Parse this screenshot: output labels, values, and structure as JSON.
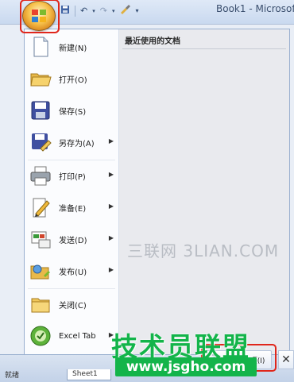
{
  "window": {
    "title": "Book1 - Microsof"
  },
  "quick_access": {
    "icons": [
      "save-icon",
      "undo-icon",
      "redo-icon",
      "brush-icon",
      "customize-icon"
    ]
  },
  "menu": {
    "items": [
      {
        "label": "新建(N)",
        "icon": "new-document-icon",
        "submenu": false
      },
      {
        "label": "打开(O)",
        "icon": "open-folder-icon",
        "submenu": false
      },
      {
        "label": "保存(S)",
        "icon": "save-icon",
        "submenu": false
      },
      {
        "label": "另存为(A)",
        "icon": "save-as-icon",
        "submenu": true
      },
      {
        "label": "打印(P)",
        "icon": "printer-icon",
        "submenu": true
      },
      {
        "label": "准备(E)",
        "icon": "prepare-icon",
        "submenu": true
      },
      {
        "label": "发送(D)",
        "icon": "send-icon",
        "submenu": true
      },
      {
        "label": "发布(U)",
        "icon": "publish-icon",
        "submenu": true
      },
      {
        "label": "关闭(C)",
        "icon": "close-folder-icon",
        "submenu": false
      },
      {
        "label": "Excel Tab",
        "icon": "excel-tab-icon",
        "submenu": true
      }
    ],
    "recent": {
      "title": "最近使用的文档"
    },
    "options_label": "Excel 选项(I)",
    "exit_label": "✕"
  },
  "sheet": {
    "tab_label": "Sheet1",
    "status": "就绪"
  },
  "watermarks": {
    "site_cn": "三联网 3LIAN.COM",
    "brand": "技术员联盟",
    "brand_url": "www.jsgho.com"
  },
  "colors": {
    "highlight": "#e0261b",
    "brand_green": "#13b44a"
  }
}
